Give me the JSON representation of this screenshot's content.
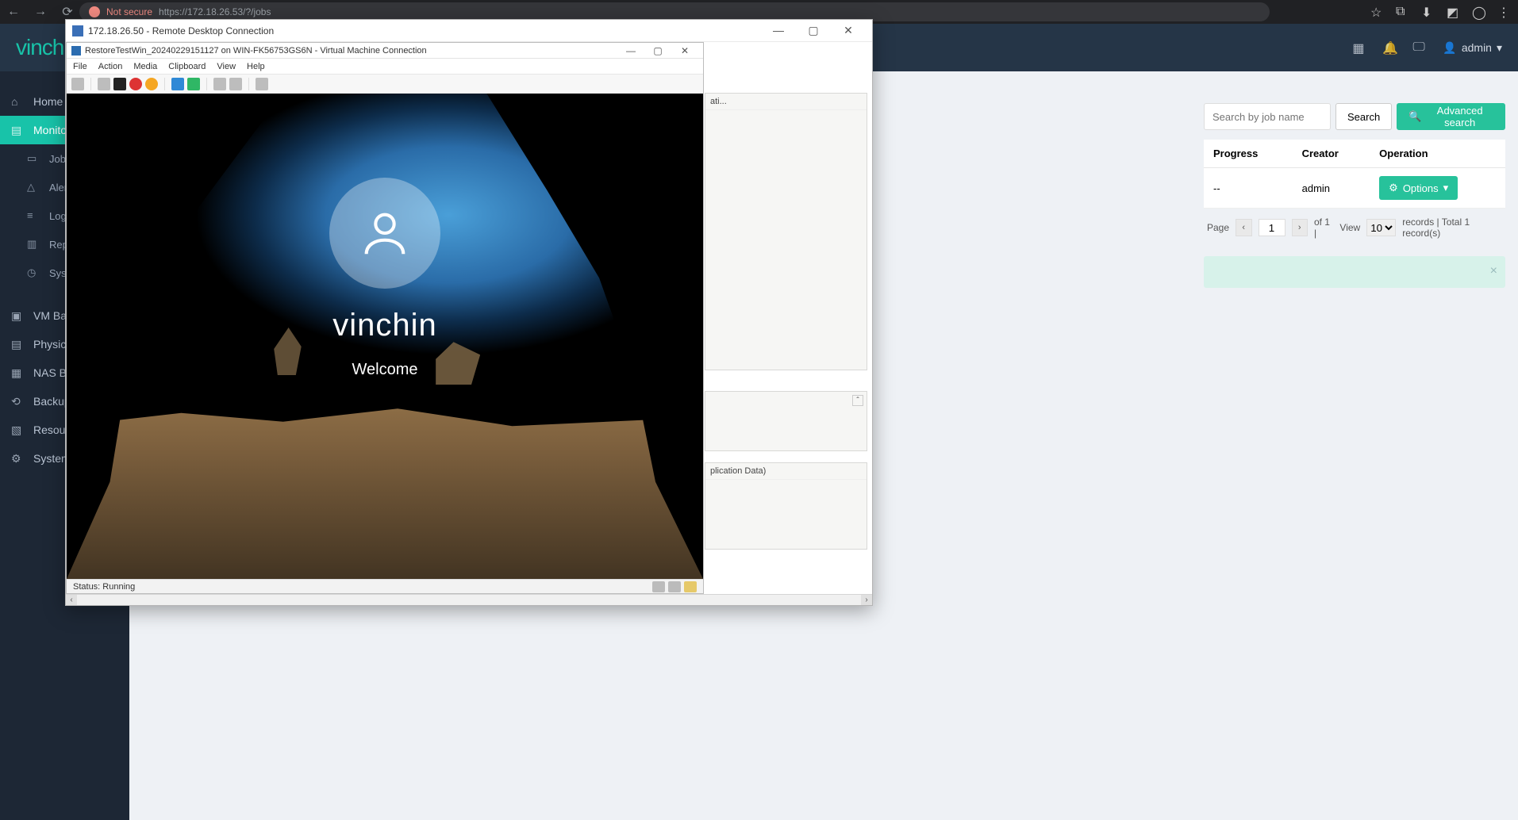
{
  "browser": {
    "not_secure": "Not secure",
    "url": "https://172.18.26.53/?/jobs"
  },
  "app_header": {
    "logo": "vinch",
    "user": "admin"
  },
  "sidebar": {
    "home": "Home",
    "monitor": "Monitor C",
    "jobs": "Jobs",
    "alerts": "Alerts",
    "logs": "Logs",
    "report": "Report",
    "system": "System",
    "vm_backup": "VM Backu",
    "physical": "Physical B",
    "nas": "NAS Back",
    "backup_v": "Backup V",
    "resource": "Resource",
    "system2": "System"
  },
  "search": {
    "placeholder": "Search by job name",
    "search_btn": "Search",
    "adv_btn": "Advanced search"
  },
  "table": {
    "col_progress": "Progress",
    "col_creator": "Creator",
    "col_operation": "Operation",
    "row1_progress": "--",
    "row1_creator": "admin",
    "options_btn": "Options"
  },
  "pager": {
    "page_lbl": "Page",
    "page_val": "1",
    "of": "of 1 |",
    "view": "View",
    "size": "10",
    "records": "records | Total 1 record(s)"
  },
  "rdp": {
    "title": "172.18.26.50 - Remote Desktop Connection"
  },
  "vmconn": {
    "title": "RestoreTestWin_20240229151127 on WIN-FK56753GS6N - Virtual Machine Connection",
    "menu": {
      "file": "File",
      "action": "Action",
      "media": "Media",
      "clipboard": "Clipboard",
      "view": "View",
      "help": "Help"
    },
    "status": "Status: Running"
  },
  "login": {
    "user": "vinchin",
    "welcome": "Welcome"
  },
  "peek": {
    "p1_text": "ati...",
    "p3_text": "plication Data)"
  }
}
